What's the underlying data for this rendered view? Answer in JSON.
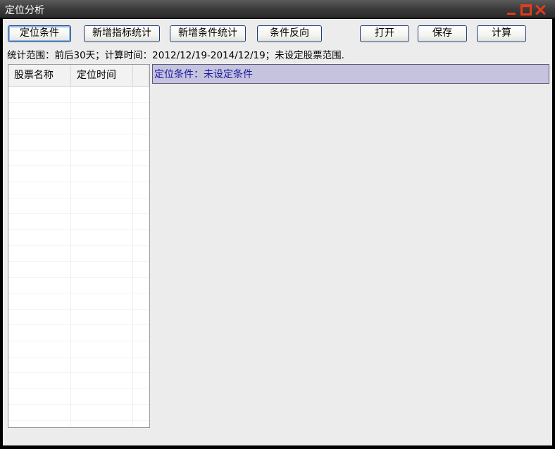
{
  "window": {
    "title": "定位分析"
  },
  "toolbar": {
    "buttons": [
      {
        "label": "定位条件"
      },
      {
        "label": "新增指标统计"
      },
      {
        "label": "新增条件统计"
      },
      {
        "label": "条件反向"
      },
      {
        "label": "打开"
      },
      {
        "label": "保存"
      },
      {
        "label": "计算"
      }
    ]
  },
  "info_line": "统计范围：前后30天；计算时间：2012/12/19-2014/12/19；未设定股票范围.",
  "stock_list": {
    "columns": [
      "股票名称",
      "定位时间",
      ""
    ],
    "rows": []
  },
  "condition_panel": {
    "text": "定位条件：未设定条件"
  }
}
